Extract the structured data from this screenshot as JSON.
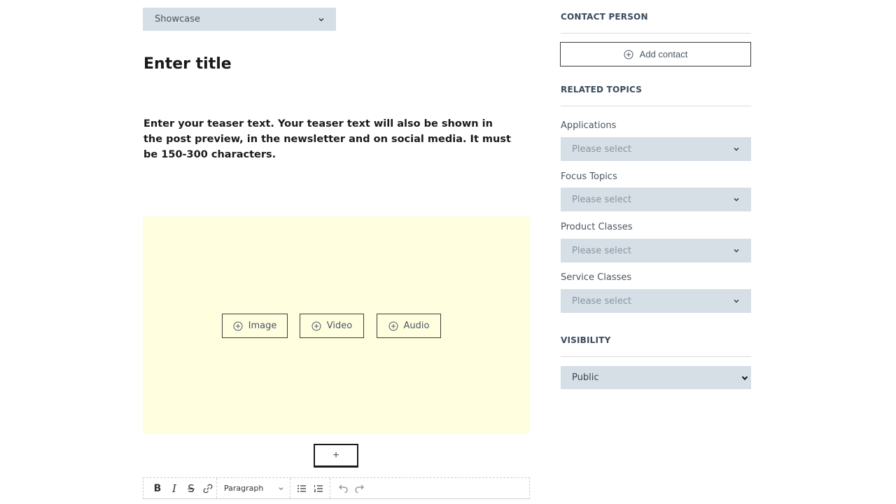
{
  "editor": {
    "post_type": "Showcase",
    "title_placeholder": "Enter title",
    "teaser_placeholder": "Enter your teaser text. Your teaser text will also be shown in the post preview, in the newsletter and on social media. It must be 150-300 characters.",
    "media_buttons": {
      "image": "Image",
      "video": "Video",
      "audio": "Audio"
    },
    "add_block": "+",
    "toolbar": {
      "bold": "B",
      "italic": "I",
      "strike": "S",
      "paragraph": "Paragraph"
    },
    "media_area_color": "#ffffe0"
  },
  "sidebar": {
    "contact": {
      "heading": "CONTACT PERSON",
      "add_label": "Add contact"
    },
    "related": {
      "heading": "RELATED TOPICS",
      "fields": [
        {
          "label": "Applications",
          "value": "Please select"
        },
        {
          "label": "Focus Topics",
          "value": "Please select"
        },
        {
          "label": "Product Classes",
          "value": "Please select"
        },
        {
          "label": "Service Classes",
          "value": "Please select"
        }
      ]
    },
    "visibility": {
      "heading": "VISIBILITY",
      "value": "Public"
    }
  },
  "colors": {
    "select_bg": "#d6dee6",
    "heading": "#3a4a5c"
  }
}
